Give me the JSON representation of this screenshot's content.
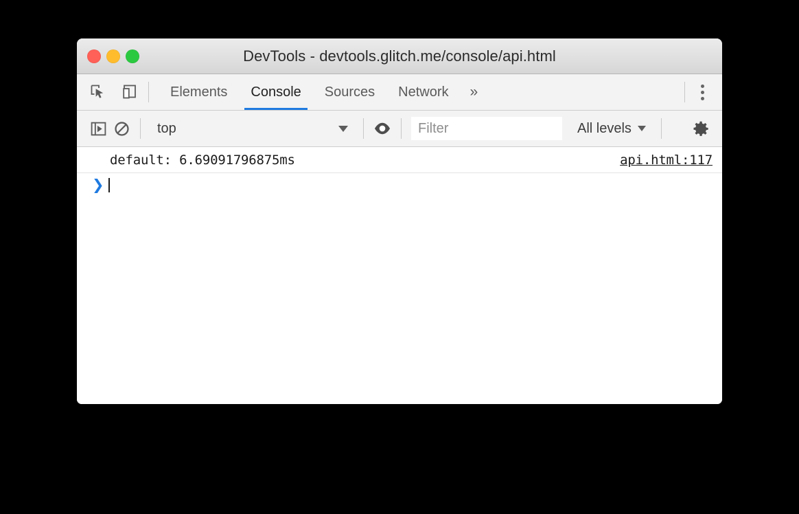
{
  "window": {
    "title": "DevTools - devtools.glitch.me/console/api.html",
    "traffic_lights": [
      {
        "name": "close",
        "color": "#ff6057"
      },
      {
        "name": "minimize",
        "color": "#ffbd2e"
      },
      {
        "name": "zoom",
        "color": "#2bc940"
      }
    ]
  },
  "tabbar": {
    "inspect_icon": "inspect-element-icon",
    "device_icon": "device-toolbar-icon",
    "tabs": [
      {
        "label": "Elements",
        "active": false
      },
      {
        "label": "Console",
        "active": true
      },
      {
        "label": "Sources",
        "active": false
      },
      {
        "label": "Network",
        "active": false
      }
    ],
    "overflow_label": "»",
    "menu_icon": "more-vertical-icon",
    "active_tab_color": "#1f7ae0"
  },
  "console_toolbar": {
    "sidebar_toggle_icon": "console-sidebar-icon",
    "clear_icon": "clear-console-icon",
    "context_value": "top",
    "eye_icon": "live-expression-icon",
    "filter_placeholder": "Filter",
    "filter_value": "",
    "levels_label": "All levels",
    "settings_icon": "gear-icon"
  },
  "console": {
    "messages": [
      {
        "text": "default: 6.69091796875ms",
        "source": "api.html:117"
      }
    ],
    "prompt_symbol": "❯",
    "prompt_value": ""
  },
  "colors": {
    "accent": "#1f7ae0",
    "toolbar_bg": "#f3f3f3",
    "titlebar_bg": "#e0e0e0",
    "page_bg": "#000000"
  }
}
